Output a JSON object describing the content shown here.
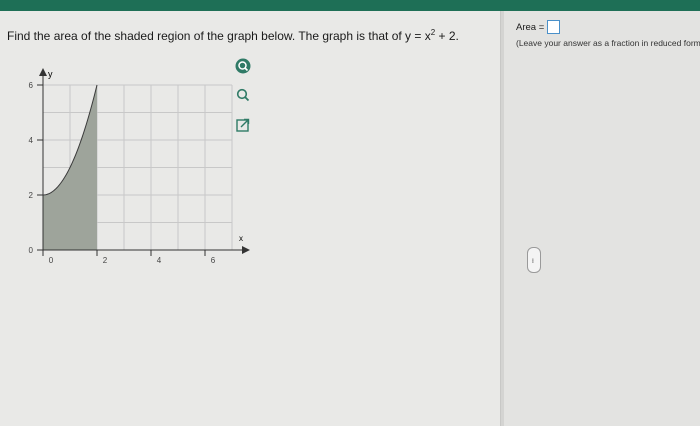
{
  "question": {
    "text": "Find the area of the shaded region of the graph below. The graph is that of y = x",
    "exponent": "2",
    "suffix": " + 2."
  },
  "graph": {
    "y_axis_label": "y",
    "x_axis_label": "x",
    "y_ticks": [
      "6",
      "4",
      "2",
      "0"
    ],
    "x_ticks": [
      "0",
      "2",
      "4",
      "6"
    ],
    "function": "y = x^2 + 2",
    "shaded_interval": [
      0,
      2
    ],
    "x_range": [
      0,
      7
    ],
    "y_range": [
      0,
      6
    ]
  },
  "toolbar": {
    "zoom_in_icon": "zoom-in-icon",
    "zoom_out_icon": "zoom-out-icon",
    "popout_icon": "external-link-icon"
  },
  "answer": {
    "label": "Area =",
    "value": "",
    "instruction": "(Leave your answer as a fraction in reduced form.)"
  },
  "more_button": {
    "label": "....."
  },
  "colors": {
    "header": "#1e6f56",
    "shade": "#9ea49b",
    "grid": "#c8c8c8",
    "answer_border": "#4a90c9"
  }
}
